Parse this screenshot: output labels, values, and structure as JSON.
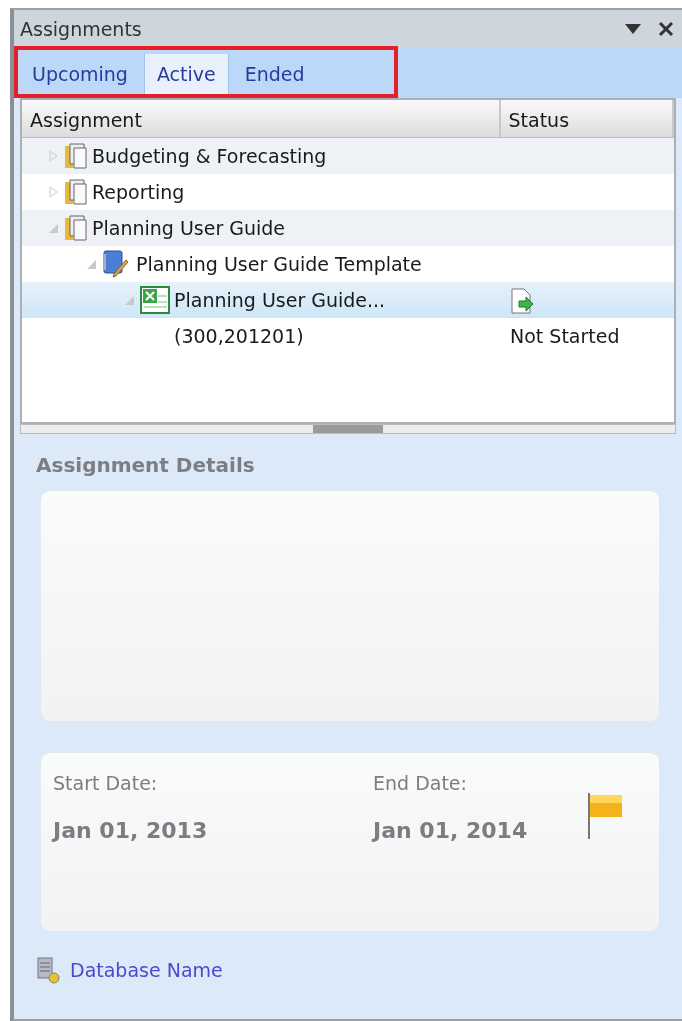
{
  "panel": {
    "title": "Assignments"
  },
  "tabs_highlighted": true,
  "tabs": [
    {
      "label": "Upcoming",
      "selected": false
    },
    {
      "label": "Active",
      "selected": true
    },
    {
      "label": "Ended",
      "selected": false
    }
  ],
  "tree": {
    "columns": [
      "Assignment",
      "Status"
    ],
    "items": [
      {
        "kind": "folder",
        "label": "Budgeting & Forecasting",
        "expanded": false,
        "selected": false
      },
      {
        "kind": "folder",
        "label": "Reporting",
        "expanded": false,
        "selected": false
      },
      {
        "kind": "folder",
        "label": "Planning User Guide",
        "expanded": true,
        "selected": false,
        "children": [
          {
            "kind": "template",
            "label": "Planning User Guide Template",
            "expanded": true,
            "selected": false,
            "children": [
              {
                "kind": "form",
                "label": "Planning User Guide...",
                "expanded": true,
                "selected": true,
                "detail": "(300,201201)",
                "status": "Not Started"
              }
            ]
          }
        ]
      }
    ]
  },
  "details": {
    "title": "Assignment Details",
    "start_label": "Start Date:",
    "start_date": "Jan 01, 2013",
    "end_label": "End Date:",
    "end_date": "Jan 01, 2014"
  },
  "footer_link": "Database Name"
}
